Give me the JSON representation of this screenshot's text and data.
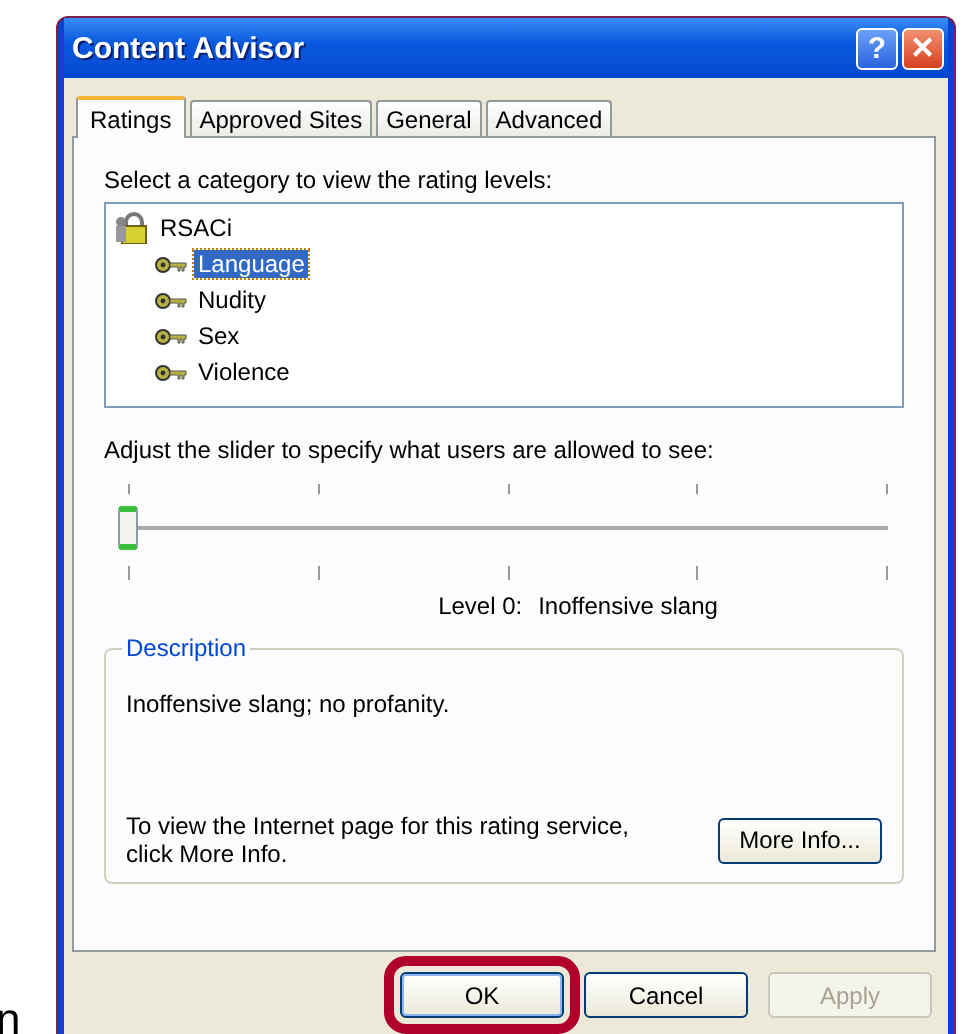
{
  "window": {
    "title": "Content Advisor"
  },
  "title_buttons": [
    {
      "kind": "help",
      "label": "?"
    },
    {
      "kind": "close",
      "label": "✕"
    }
  ],
  "tabs": [
    {
      "label": "Ratings",
      "selected": true
    },
    {
      "label": "Approved Sites",
      "selected": false
    },
    {
      "label": "General",
      "selected": false
    },
    {
      "label": "Advanced",
      "selected": false
    }
  ],
  "category_prompt": "Select a category to view the rating levels:",
  "tree": {
    "label": "RSACi",
    "children": [
      {
        "label": "Language",
        "selected": true
      },
      {
        "label": "Nudity",
        "selected": false
      },
      {
        "label": "Sex",
        "selected": false
      },
      {
        "label": "Violence",
        "selected": false
      }
    ]
  },
  "slider_prompt": "Adjust the slider to specify what users are allowed to see:",
  "slider": {
    "level": 0
  },
  "level_reading": {
    "level": "Level 0:",
    "text": "Inoffensive slang"
  },
  "description": {
    "title": "Description",
    "text": "Inoffensive slang; no profanity.",
    "info_text": "To view the Internet page for this rating service, click More Info.",
    "info_button": "More Info..."
  },
  "buttons": [
    {
      "label": "OK",
      "disabled": false,
      "highlighted": true
    },
    {
      "label": "Cancel",
      "disabled": false,
      "highlighted": false
    },
    {
      "label": "Apply",
      "disabled": true,
      "highlighted": false
    }
  ],
  "edge_fragment": "n"
}
